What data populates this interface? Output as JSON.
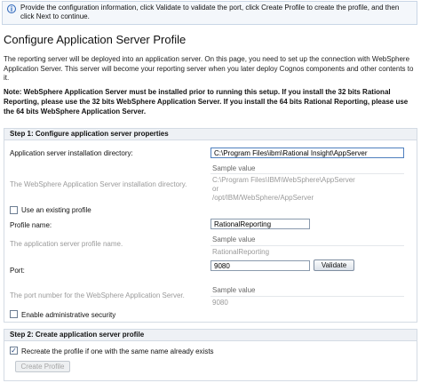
{
  "banner": {
    "icon": "info-icon",
    "text": "Provide the configuration information, click Validate to validate the port, click Create Profile to create the profile, and then click Next to continue."
  },
  "page_title": "Configure Application Server Profile",
  "intro": "The reporting server will be deployed into an application server. On this page, you need to set up the connection with WebSphere Application Server. This server will become your reporting server when you later deploy Cognos components and other contents to it.",
  "note": "Note: WebSphere Application Server must be installed prior to running this setup. If you install the 32 bits Rational Reporting, please use the 32 bits WebSphere Application Server. If you install the 64 bits Rational Reporting, please use the 64 bits WebSphere Application Server.",
  "step1": {
    "header": "Step 1:   Configure application server properties",
    "install_dir": {
      "label": "Application server installation directory:",
      "value": "C:\\Program Files\\ibm\\Rational Insight\\AppServer",
      "description": "The WebSphere Application Server installation directory.",
      "sample_head": "Sample value",
      "sample_1": "C:\\Program Files\\IBM\\WebSphere\\AppServer",
      "sample_2": "or",
      "sample_3": "/opt/IBM/WebSphere/AppServer"
    },
    "use_existing_label": "Use an existing profile",
    "profile": {
      "label": "Profile name:",
      "value": "RationalReporting",
      "description": "The application server profile name.",
      "sample_head": "Sample value",
      "sample": "RationalReporting"
    },
    "port": {
      "label": "Port:",
      "value": "9080",
      "validate_label": "Validate",
      "description": "The port number for the WebSphere Application Server.",
      "sample_head": "Sample value",
      "sample": "9080"
    },
    "admin_security_label": "Enable administrative security"
  },
  "step2": {
    "header": "Step 2:   Create application server profile",
    "recreate_label": "Recreate the profile if one with the same name already exists",
    "recreate_checked": true,
    "create_label": "Create Profile"
  },
  "colors": {
    "banner_bg": "#f4f7fb",
    "section_header_bg": "#eef1f5",
    "accent": "#2a63b8"
  }
}
